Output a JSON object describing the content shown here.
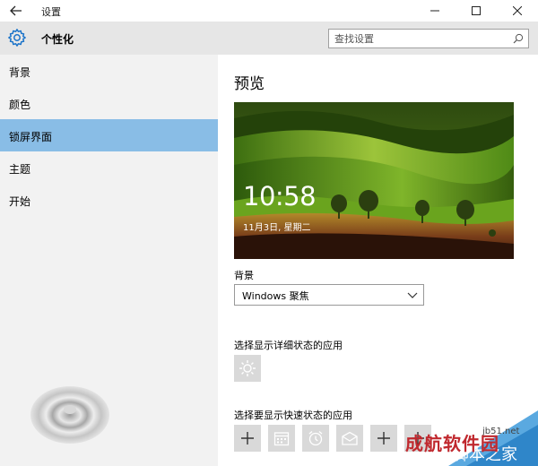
{
  "window": {
    "title": "设置",
    "back_glyph": "←",
    "min_glyph": "—",
    "max_glyph": "☐",
    "close_glyph": "✕"
  },
  "header": {
    "title": "个性化",
    "search_placeholder": "查找设置"
  },
  "sidebar": {
    "items": [
      {
        "label": "背景",
        "active": false
      },
      {
        "label": "颜色",
        "active": false
      },
      {
        "label": "锁屏界面",
        "active": true
      },
      {
        "label": "主题",
        "active": false
      },
      {
        "label": "开始",
        "active": false
      }
    ]
  },
  "main": {
    "title": "预览",
    "preview": {
      "time": "10:58",
      "date": "11月3日, 星期二"
    },
    "background_label": "背景",
    "background_value": "Windows 聚焦",
    "detailed_status_label": "选择显示详细状态的应用",
    "quick_status_label": "选择要显示快速状态的应用",
    "quick_tiles": [
      "plus-icon",
      "calendar-icon",
      "alarm-clock-icon",
      "mail-icon",
      "plus-icon",
      "plus-icon"
    ]
  },
  "watermark": {
    "brand": "成航软件园",
    "site": "jb51.net",
    "text": "脚本之家"
  },
  "colors": {
    "accent_selected": "#89bde6",
    "sidebar_bg": "#f2f2f2",
    "header_bg": "#e6e6e6",
    "gear": "#1a73c9"
  }
}
